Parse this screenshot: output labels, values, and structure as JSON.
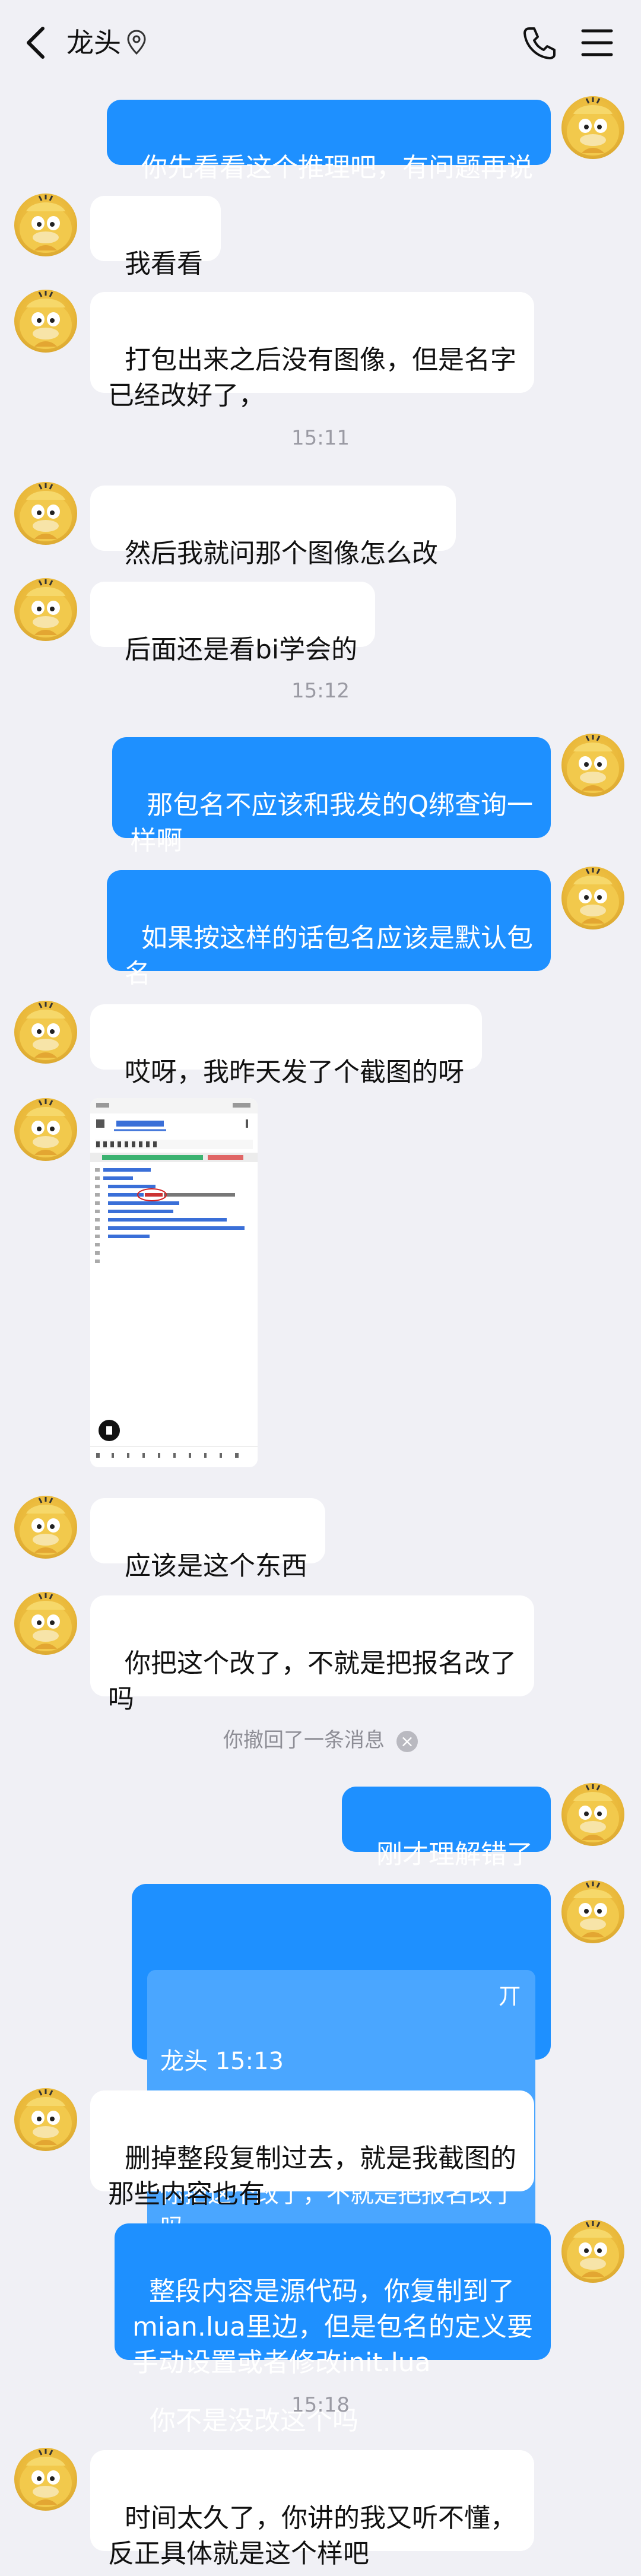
{
  "header": {
    "title": "龙头",
    "back_icon": "chevron-left-icon",
    "ip_icon": "location-pin-icon",
    "call_icon": "phone-icon",
    "menu_icon": "hamburger-menu-icon"
  },
  "messages": {
    "m1": "你先看看这个推理吧，有问题再说",
    "m2": "我看看",
    "m3": "打包出来之后没有图像，但是名字\n已经改好了，",
    "t1": "15:11",
    "m4": "然后我就问那个图像怎么改",
    "m5": "后面还是看bi学会的",
    "t2": "15:12",
    "m6": "那包名不应该和我发的Q绑查询一\n样啊",
    "m7": "如果按这样的话包名应该是默认包\n名",
    "m8": "哎呀，我昨天发了个截图的呀",
    "m9": "应该是这个东西",
    "m10": "你把这个改了，不就是把报名改了\n吗",
    "recall": "你撤回了一条消息",
    "m11": "刚才理解错了",
    "reply": {
      "quote_author": "龙头",
      "quote_time": "15:13",
      "quote_mark": "丌",
      "quote_text": "你把这个改了，不就是把报名改了吗",
      "text": "你不是没改这个吗"
    },
    "m12": "删掉整段复制过去，就是我截图的\n那些内容也有",
    "m13": "整段内容是源代码，你复制到了\nmian.lua里边，但是包名的定义要\n手动设置或者修改init.lua",
    "t3": "15:18",
    "m14": "时间太久了，你讲的我又听不懂，\n反正具体就是这个样吧"
  },
  "colors": {
    "background": "#f0f0f5",
    "outgoing_bubble": "#1e90ff",
    "incoming_bubble": "#ffffff",
    "timestamp": "#9a9aa3"
  }
}
